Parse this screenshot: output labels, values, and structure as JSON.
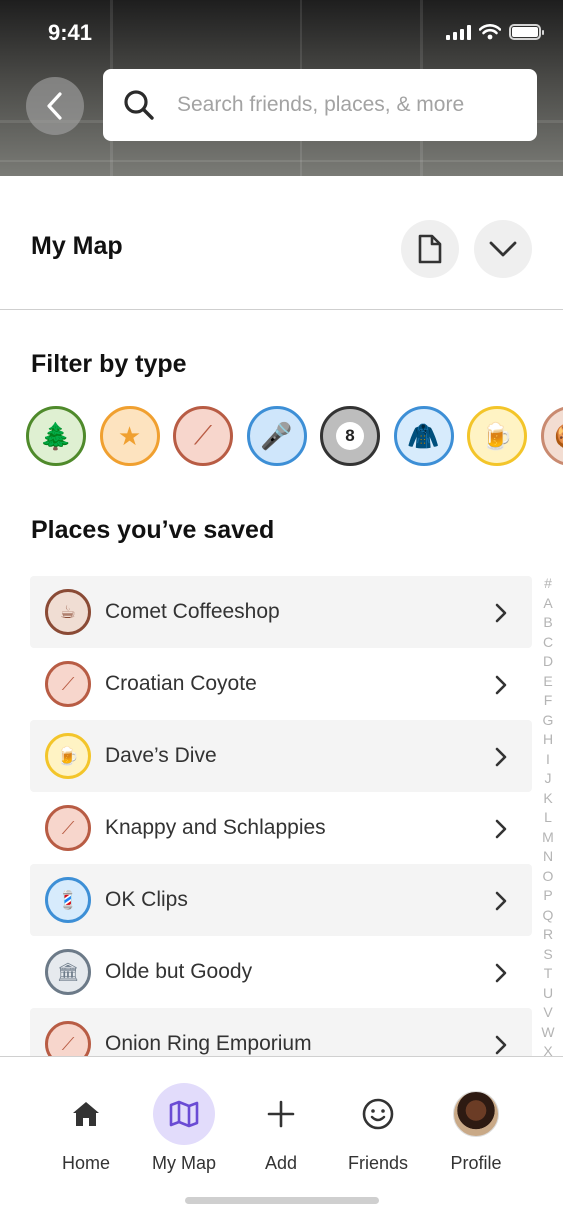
{
  "status_bar": {
    "time": "9:41"
  },
  "search": {
    "placeholder": "Search friends, places, & more"
  },
  "my_map": {
    "title": "My Map"
  },
  "filters": {
    "title": "Filter by type",
    "chips": [
      {
        "icon": "tree-icon",
        "glyph": "🌲",
        "border": "#4f8a2b",
        "bg": "#dff0d2"
      },
      {
        "icon": "star-icon",
        "glyph": "★",
        "border": "#f0a030",
        "bg": "#fde3bf"
      },
      {
        "icon": "chopsticks-icon",
        "glyph": "⟋",
        "border": "#b85c44",
        "bg": "#f7d6cc"
      },
      {
        "icon": "microphone-icon",
        "glyph": "🎤",
        "border": "#3d8fd6",
        "bg": "#cfe6fb"
      },
      {
        "icon": "eight-ball-icon",
        "glyph": "8",
        "border": "#333333",
        "bg": "#bdbdbd"
      },
      {
        "icon": "jacket-icon",
        "glyph": "🧥",
        "border": "#3d8fd6",
        "bg": "#d7ebfc"
      },
      {
        "icon": "beer-icon",
        "glyph": "🍺",
        "border": "#f3c52a",
        "bg": "#fff3c4"
      },
      {
        "icon": "food-icon",
        "glyph": "🍪",
        "border": "#c98a70",
        "bg": "#f3ddd2"
      }
    ]
  },
  "places": {
    "title": "Places you’ve saved",
    "items": [
      {
        "name": "Comet Coffeeshop",
        "icon": "coffee-icon",
        "glyph": "☕",
        "border": "#8a4a35",
        "bg": "#f0ddd3"
      },
      {
        "name": "Croatian Coyote",
        "icon": "chopsticks-icon",
        "glyph": "⟋",
        "border": "#b85c44",
        "bg": "#f7d6cc"
      },
      {
        "name": "Dave’s Dive",
        "icon": "beer-icon",
        "glyph": "🍺",
        "border": "#f3c52a",
        "bg": "#fff3c4"
      },
      {
        "name": "Knappy and Schlappies",
        "icon": "chopsticks-icon",
        "glyph": "⟋",
        "border": "#b85c44",
        "bg": "#f7d6cc"
      },
      {
        "name": "OK Clips",
        "icon": "barber-pole-icon",
        "glyph": "💈",
        "border": "#3d8fd6",
        "bg": "#d7ebfc"
      },
      {
        "name": "Olde but Goody",
        "icon": "museum-icon",
        "glyph": "🏛",
        "border": "#6c7a88",
        "bg": "#e6eaee"
      },
      {
        "name": "Onion Ring Emporium",
        "icon": "chopsticks-icon",
        "glyph": "⟋",
        "border": "#b85c44",
        "bg": "#f7d6cc"
      }
    ]
  },
  "index_letters": [
    "#",
    "A",
    "B",
    "C",
    "D",
    "E",
    "F",
    "G",
    "H",
    "I",
    "J",
    "K",
    "L",
    "M",
    "N",
    "O",
    "P",
    "Q",
    "R",
    "S",
    "T",
    "U",
    "V",
    "W",
    "X"
  ],
  "nav": {
    "items": [
      {
        "label": "Home",
        "icon": "home-icon"
      },
      {
        "label": "My Map",
        "icon": "map-icon",
        "active": true
      },
      {
        "label": "Add",
        "icon": "plus-icon"
      },
      {
        "label": "Friends",
        "icon": "smiley-icon"
      },
      {
        "label": "Profile",
        "icon": "avatar"
      }
    ]
  },
  "colors": {
    "accent": "#6a4bd4",
    "accent_bg": "#e2dcfb"
  }
}
